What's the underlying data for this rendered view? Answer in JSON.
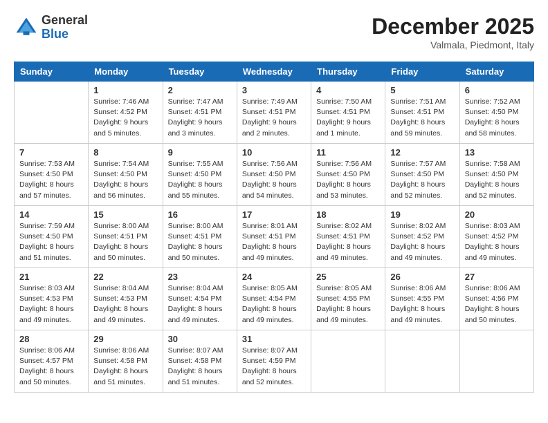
{
  "header": {
    "logo_general": "General",
    "logo_blue": "Blue",
    "month": "December 2025",
    "location": "Valmala, Piedmont, Italy"
  },
  "weekdays": [
    "Sunday",
    "Monday",
    "Tuesday",
    "Wednesday",
    "Thursday",
    "Friday",
    "Saturday"
  ],
  "weeks": [
    [
      {
        "day": "",
        "info": ""
      },
      {
        "day": "1",
        "info": "Sunrise: 7:46 AM\nSunset: 4:52 PM\nDaylight: 9 hours\nand 5 minutes."
      },
      {
        "day": "2",
        "info": "Sunrise: 7:47 AM\nSunset: 4:51 PM\nDaylight: 9 hours\nand 3 minutes."
      },
      {
        "day": "3",
        "info": "Sunrise: 7:49 AM\nSunset: 4:51 PM\nDaylight: 9 hours\nand 2 minutes."
      },
      {
        "day": "4",
        "info": "Sunrise: 7:50 AM\nSunset: 4:51 PM\nDaylight: 9 hours\nand 1 minute."
      },
      {
        "day": "5",
        "info": "Sunrise: 7:51 AM\nSunset: 4:51 PM\nDaylight: 8 hours\nand 59 minutes."
      },
      {
        "day": "6",
        "info": "Sunrise: 7:52 AM\nSunset: 4:50 PM\nDaylight: 8 hours\nand 58 minutes."
      }
    ],
    [
      {
        "day": "7",
        "info": "Sunrise: 7:53 AM\nSunset: 4:50 PM\nDaylight: 8 hours\nand 57 minutes."
      },
      {
        "day": "8",
        "info": "Sunrise: 7:54 AM\nSunset: 4:50 PM\nDaylight: 8 hours\nand 56 minutes."
      },
      {
        "day": "9",
        "info": "Sunrise: 7:55 AM\nSunset: 4:50 PM\nDaylight: 8 hours\nand 55 minutes."
      },
      {
        "day": "10",
        "info": "Sunrise: 7:56 AM\nSunset: 4:50 PM\nDaylight: 8 hours\nand 54 minutes."
      },
      {
        "day": "11",
        "info": "Sunrise: 7:56 AM\nSunset: 4:50 PM\nDaylight: 8 hours\nand 53 minutes."
      },
      {
        "day": "12",
        "info": "Sunrise: 7:57 AM\nSunset: 4:50 PM\nDaylight: 8 hours\nand 52 minutes."
      },
      {
        "day": "13",
        "info": "Sunrise: 7:58 AM\nSunset: 4:50 PM\nDaylight: 8 hours\nand 52 minutes."
      }
    ],
    [
      {
        "day": "14",
        "info": "Sunrise: 7:59 AM\nSunset: 4:50 PM\nDaylight: 8 hours\nand 51 minutes."
      },
      {
        "day": "15",
        "info": "Sunrise: 8:00 AM\nSunset: 4:51 PM\nDaylight: 8 hours\nand 50 minutes."
      },
      {
        "day": "16",
        "info": "Sunrise: 8:00 AM\nSunset: 4:51 PM\nDaylight: 8 hours\nand 50 minutes."
      },
      {
        "day": "17",
        "info": "Sunrise: 8:01 AM\nSunset: 4:51 PM\nDaylight: 8 hours\nand 49 minutes."
      },
      {
        "day": "18",
        "info": "Sunrise: 8:02 AM\nSunset: 4:51 PM\nDaylight: 8 hours\nand 49 minutes."
      },
      {
        "day": "19",
        "info": "Sunrise: 8:02 AM\nSunset: 4:52 PM\nDaylight: 8 hours\nand 49 minutes."
      },
      {
        "day": "20",
        "info": "Sunrise: 8:03 AM\nSunset: 4:52 PM\nDaylight: 8 hours\nand 49 minutes."
      }
    ],
    [
      {
        "day": "21",
        "info": "Sunrise: 8:03 AM\nSunset: 4:53 PM\nDaylight: 8 hours\nand 49 minutes."
      },
      {
        "day": "22",
        "info": "Sunrise: 8:04 AM\nSunset: 4:53 PM\nDaylight: 8 hours\nand 49 minutes."
      },
      {
        "day": "23",
        "info": "Sunrise: 8:04 AM\nSunset: 4:54 PM\nDaylight: 8 hours\nand 49 minutes."
      },
      {
        "day": "24",
        "info": "Sunrise: 8:05 AM\nSunset: 4:54 PM\nDaylight: 8 hours\nand 49 minutes."
      },
      {
        "day": "25",
        "info": "Sunrise: 8:05 AM\nSunset: 4:55 PM\nDaylight: 8 hours\nand 49 minutes."
      },
      {
        "day": "26",
        "info": "Sunrise: 8:06 AM\nSunset: 4:55 PM\nDaylight: 8 hours\nand 49 minutes."
      },
      {
        "day": "27",
        "info": "Sunrise: 8:06 AM\nSunset: 4:56 PM\nDaylight: 8 hours\nand 50 minutes."
      }
    ],
    [
      {
        "day": "28",
        "info": "Sunrise: 8:06 AM\nSunset: 4:57 PM\nDaylight: 8 hours\nand 50 minutes."
      },
      {
        "day": "29",
        "info": "Sunrise: 8:06 AM\nSunset: 4:58 PM\nDaylight: 8 hours\nand 51 minutes."
      },
      {
        "day": "30",
        "info": "Sunrise: 8:07 AM\nSunset: 4:58 PM\nDaylight: 8 hours\nand 51 minutes."
      },
      {
        "day": "31",
        "info": "Sunrise: 8:07 AM\nSunset: 4:59 PM\nDaylight: 8 hours\nand 52 minutes."
      },
      {
        "day": "",
        "info": ""
      },
      {
        "day": "",
        "info": ""
      },
      {
        "day": "",
        "info": ""
      }
    ]
  ]
}
